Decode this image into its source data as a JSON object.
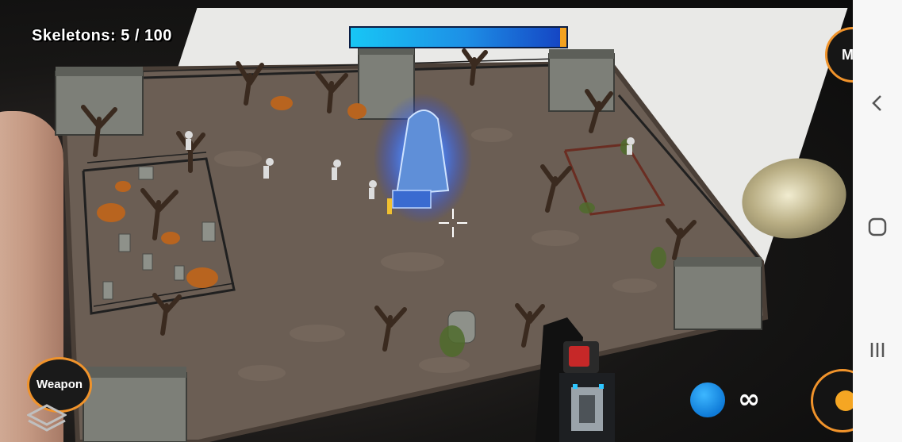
{
  "hud": {
    "skeleton_counter": "Skeletons: 5 / 100",
    "health_level": 0.97,
    "menu_label": "M",
    "weapon_label": "Weapon",
    "ammo_symbol": "∞"
  },
  "icons": {
    "crosshair": "crosshair-icon",
    "layers": "layers-icon",
    "ammo": "blue-orb-icon",
    "fire": "fire-icon",
    "nav_back": "chevron-left-icon",
    "nav_home": "rounded-square-icon",
    "nav_recents": "three-bars-icon"
  },
  "colors": {
    "accent": "#f0932b",
    "health_start": "#18c6f5",
    "health_end": "#1546c4",
    "ammo_orb": "#0f7bd8"
  }
}
